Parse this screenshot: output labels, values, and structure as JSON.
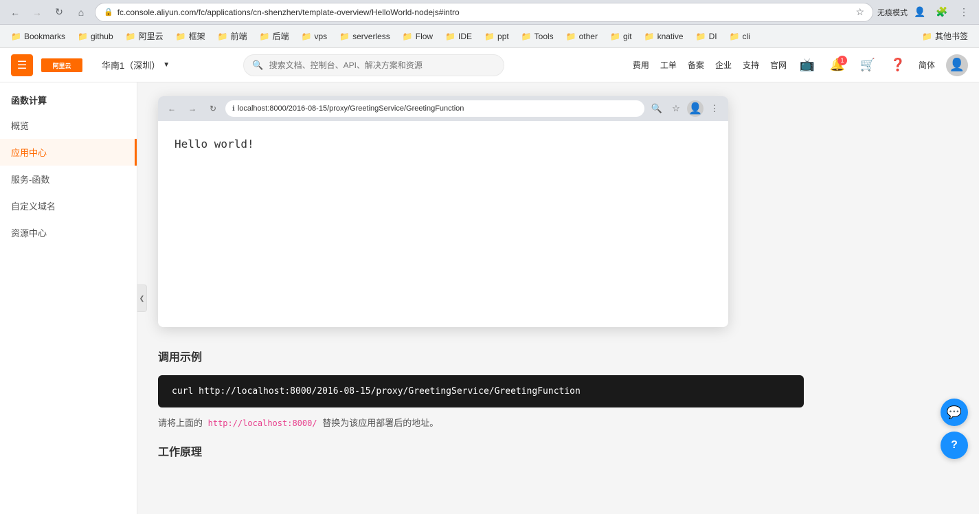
{
  "browser": {
    "url": "fc.console.aliyun.com/fc/applications/cn-shenzhen/template-overview/HelloWorld-nodejs#intro",
    "incognito_label": "无痕模式",
    "back_disabled": false,
    "forward_disabled": true
  },
  "bookmarks": {
    "items": [
      {
        "label": "Bookmarks",
        "icon": "📁"
      },
      {
        "label": "github",
        "icon": "📁"
      },
      {
        "label": "阿里云",
        "icon": "📁"
      },
      {
        "label": "框架",
        "icon": "📁"
      },
      {
        "label": "前端",
        "icon": "📁"
      },
      {
        "label": "后端",
        "icon": "📁"
      },
      {
        "label": "vps",
        "icon": "📁"
      },
      {
        "label": "serverless",
        "icon": "📁"
      },
      {
        "label": "Flow",
        "icon": "📁"
      },
      {
        "label": "IDE",
        "icon": "📁"
      },
      {
        "label": "ppt",
        "icon": "📁"
      },
      {
        "label": "Tools",
        "icon": "📁"
      },
      {
        "label": "other",
        "icon": "📁"
      },
      {
        "label": "git",
        "icon": "📁"
      },
      {
        "label": "knative",
        "icon": "📁"
      },
      {
        "label": "DI",
        "icon": "📁"
      },
      {
        "label": "cli",
        "icon": "📁"
      }
    ],
    "other_label": "其他书签"
  },
  "topnav": {
    "logo": "阿里云",
    "region": "华南1（深圳）",
    "search_placeholder": "搜索文档、控制台、API、解决方案和资源",
    "actions": [
      {
        "label": "费用"
      },
      {
        "label": "工单"
      },
      {
        "label": "备案"
      },
      {
        "label": "企业"
      },
      {
        "label": "支持"
      },
      {
        "label": "官网"
      }
    ]
  },
  "sidebar": {
    "title": "函数计算",
    "items": [
      {
        "label": "概览",
        "active": false
      },
      {
        "label": "应用中心",
        "active": true
      },
      {
        "label": "服务-函数",
        "active": false
      },
      {
        "label": "自定义域名",
        "active": false
      },
      {
        "label": "资源中心",
        "active": false
      }
    ]
  },
  "mockup_browser": {
    "url": "localhost:8000/2016-08-15/proxy/GreetingService/GreetingFunction",
    "content": "Hello world!"
  },
  "sections": [
    {
      "id": "invoke-example",
      "title": "调用示例",
      "code": "curl http://localhost:8000/2016-08-15/proxy/GreetingService/GreetingFunction",
      "description": "请将上面的 http://localhost:8000/ 替换为该应用部署后的地址。"
    },
    {
      "id": "how-it-works",
      "title": "工作原理"
    }
  ],
  "chat_icon": "💬",
  "help_icon": "?"
}
